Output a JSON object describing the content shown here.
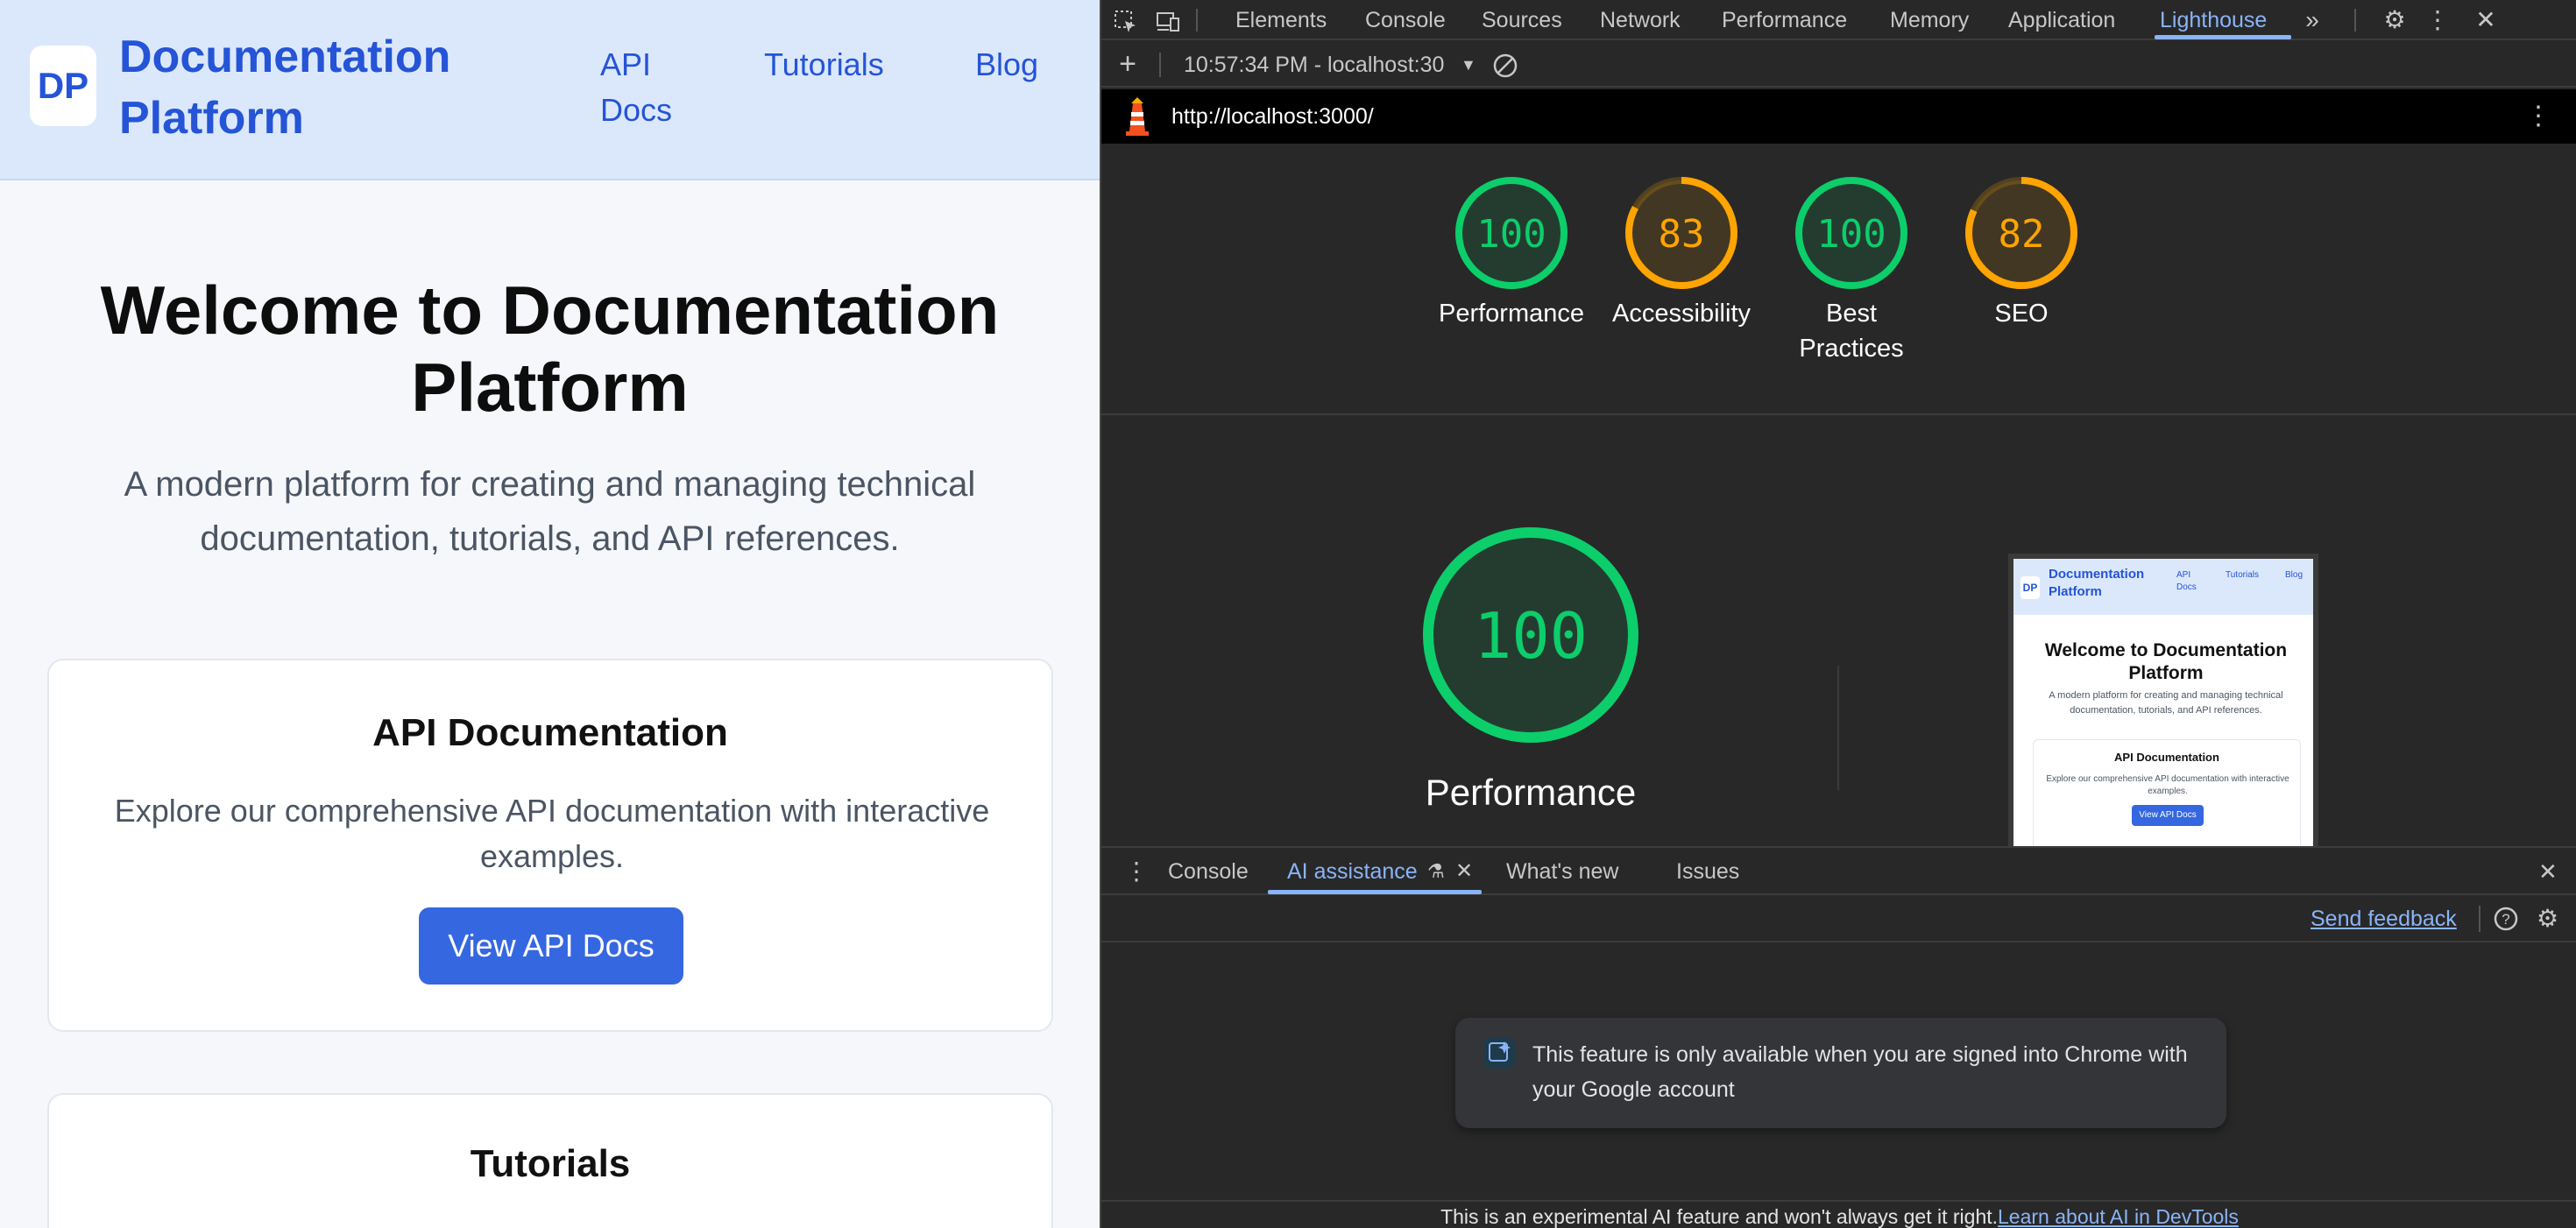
{
  "site": {
    "logo_text": "DP",
    "brand": "Documentation Platform",
    "nav": [
      "API Docs",
      "Tutorials",
      "Blog"
    ],
    "hero_title": "Welcome to Documentation Platform",
    "hero_subtitle": "A modern platform for creating and managing technical documentation, tutorials, and API references.",
    "cards": [
      {
        "title": "API Documentation",
        "desc": "Explore our comprehensive API documentation with interactive examples.",
        "button": "View API Docs"
      },
      {
        "title": "Tutorials"
      }
    ]
  },
  "devtools": {
    "tabs": [
      "Elements",
      "Console",
      "Sources",
      "Network",
      "Performance",
      "Memory",
      "Application",
      "Lighthouse"
    ],
    "active_tab": "Lighthouse",
    "report_selector": "10:57:34 PM - localhost:30",
    "url": "http://localhost:3000/",
    "scores": [
      {
        "label": "Performance",
        "value": 100,
        "color": "#0cce6b"
      },
      {
        "label": "Accessibility",
        "value": 83,
        "color": "#ffa400"
      },
      {
        "label": "Best Practices",
        "value": 100,
        "color": "#0cce6b"
      },
      {
        "label": "SEO",
        "value": 82,
        "color": "#ffa400"
      }
    ],
    "featured": {
      "label": "Performance",
      "value": 100
    },
    "thumbnail": {
      "logo": "DP",
      "brand": "Documentation Platform",
      "nav": [
        "API Docs",
        "Tutorials",
        "Blog"
      ],
      "title": "Welcome to Documentation Platform",
      "subtitle": "A modern platform for creating and managing technical documentation, tutorials, and API references.",
      "card_title": "API Documentation",
      "card_desc": "Explore our comprehensive API documentation with interactive examples.",
      "card_button": "View API Docs"
    },
    "drawer": {
      "tabs": [
        "Console",
        "AI assistance",
        "What's new",
        "Issues"
      ],
      "active_tab": "AI assistance",
      "send_feedback": "Send feedback",
      "notice": "This feature is only available when you are signed into Chrome with your Google account",
      "footer_text": "This is an experimental AI feature and won't always get it right.",
      "footer_link": "Learn about AI in DevTools"
    }
  },
  "colors": {
    "good": "#0cce6b",
    "average": "#ffa400",
    "accent": "#8ab4f8",
    "brand": "#2554d6"
  }
}
